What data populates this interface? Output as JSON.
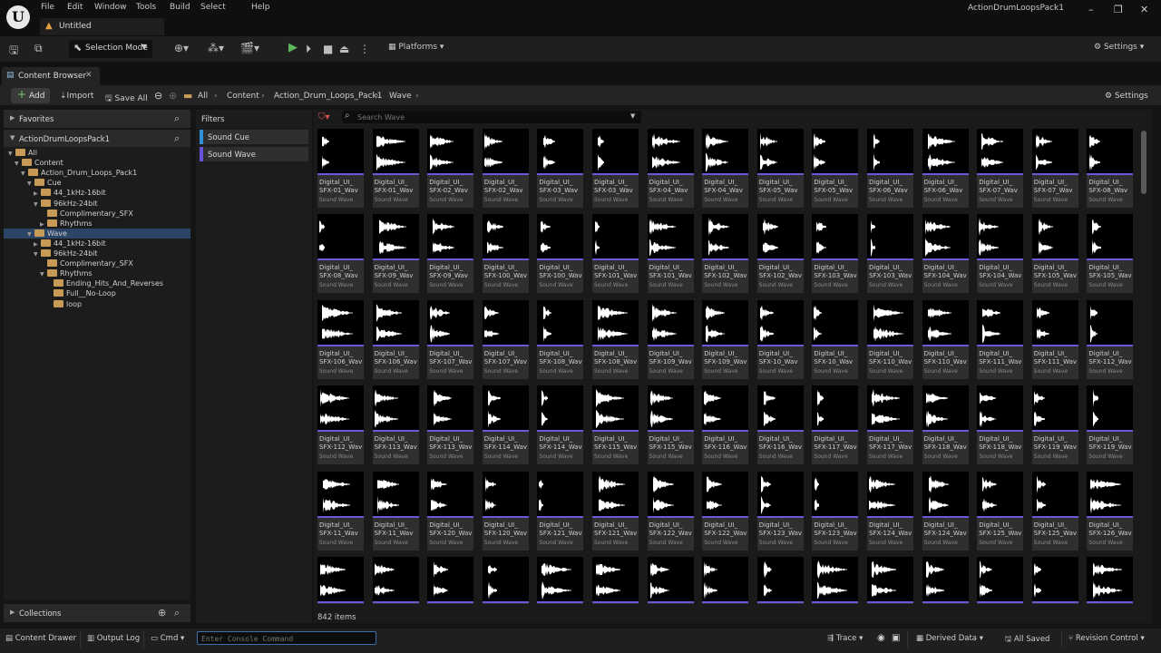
{
  "menu": [
    "File",
    "Edit",
    "Window",
    "Tools",
    "Build",
    "Select",
    "Help"
  ],
  "document_tab": "Untitled",
  "project_name": "ActionDrumLoopsPack1",
  "toolbar": {
    "selection_mode": "Selection Mode",
    "platforms": "Platforms",
    "settings": "Settings"
  },
  "content_browser": {
    "tab_label": "Content Browser",
    "add_label": "Add",
    "import_label": "Import",
    "save_all_label": "Save All",
    "breadcrumb": [
      "All",
      "Content",
      "Action_Drum_Loops_Pack1",
      "Wave"
    ],
    "settings_label": "Settings",
    "favorites_label": "Favorites",
    "project_label": "ActionDrumLoopsPack1",
    "collections_label": "Collections",
    "filters_label": "Filters",
    "filters": [
      {
        "label": "Sound Cue",
        "color": "#2f8fd8"
      },
      {
        "label": "Sound Wave",
        "color": "#6a4fd8"
      }
    ],
    "search_placeholder": "Search Wave",
    "item_count": "842 items",
    "tree": [
      {
        "label": "All",
        "depth": 0,
        "arrow": "▼"
      },
      {
        "label": "Content",
        "depth": 1,
        "arrow": "▼"
      },
      {
        "label": "Action_Drum_Loops_Pack1",
        "depth": 2,
        "arrow": "▼"
      },
      {
        "label": "Cue",
        "depth": 3,
        "arrow": "▼"
      },
      {
        "label": "44_1kHz-16bit",
        "depth": 4,
        "arrow": "▶"
      },
      {
        "label": "96kHz-24bit",
        "depth": 4,
        "arrow": "▼"
      },
      {
        "label": "Complimentary_SFX",
        "depth": 5,
        "arrow": ""
      },
      {
        "label": "Rhythms",
        "depth": 5,
        "arrow": "▶"
      },
      {
        "label": "Wave",
        "depth": 3,
        "arrow": "▼"
      },
      {
        "label": "44_1kHz-16bit",
        "depth": 4,
        "arrow": "▶"
      },
      {
        "label": "96kHz-24bit",
        "depth": 4,
        "arrow": "▼"
      },
      {
        "label": "Complimentary_SFX",
        "depth": 5,
        "arrow": ""
      },
      {
        "label": "Rhythms",
        "depth": 5,
        "arrow": "▼"
      },
      {
        "label": "Ending_Hits_And_Reverses",
        "depth": 6,
        "arrow": ""
      },
      {
        "label": "Full__No-Loop",
        "depth": 6,
        "arrow": ""
      },
      {
        "label": "loop",
        "depth": 6,
        "arrow": ""
      }
    ],
    "asset_type_label": "Sound Wave",
    "asset_name_prefix": "Digital_UI_",
    "assets": [
      "SFX-01_Wav",
      "SFX-01_Wav",
      "SFX-02_Wav",
      "SFX-02_Wav",
      "SFX-03_Wav",
      "SFX-03_Wav",
      "SFX-04_Wav",
      "SFX-04_Wav",
      "SFX-05_Wav",
      "SFX-05_Wav",
      "SFX-06_Wav",
      "SFX-06_Wav",
      "SFX-07_Wav",
      "SFX-07_Wav",
      "SFX-08_Wav",
      "SFX-08_Wav",
      "SFX-09_Wav",
      "SFX-09_Wav",
      "SFX-100_Wav",
      "SFX-100_Wav",
      "SFX-101_Wav",
      "SFX-101_Wav",
      "SFX-102_Wav",
      "SFX-102_Wav",
      "SFX-103_Wav",
      "SFX-103_Wav",
      "SFX-104_Wav",
      "SFX-104_Wav",
      "SFX-105_Wav",
      "SFX-105_Wav",
      "SFX-106_Wav",
      "SFX-106_Wav",
      "SFX-107_Wav",
      "SFX-107_Wav",
      "SFX-108_Wav",
      "SFX-108_Wav",
      "SFX-109_Wav",
      "SFX-109_Wav",
      "SFX-10_Wav",
      "SFX-10_Wav",
      "SFX-110_Wav",
      "SFX-110_Wav",
      "SFX-111_Wav",
      "SFX-111_Wav",
      "SFX-112_Wav",
      "SFX-112_Wav",
      "SFX-113_Wav",
      "SFX-113_Wav",
      "SFX-114_Wav",
      "SFX-114_Wav",
      "SFX-115_Wav",
      "SFX-115_Wav",
      "SFX-116_Wav",
      "SFX-116_Wav",
      "SFX-117_Wav",
      "SFX-117_Wav",
      "SFX-118_Wav",
      "SFX-118_Wav",
      "SFX-119_Wav",
      "SFX-119_Wav",
      "SFX-11_Wav",
      "SFX-11_Wav",
      "SFX-120_Wav",
      "SFX-120_Wav",
      "SFX-121_Wav",
      "SFX-121_Wav",
      "SFX-122_Wav",
      "SFX-122_Wav",
      "SFX-123_Wav",
      "SFX-123_Wav",
      "SFX-124_Wav",
      "SFX-124_Wav",
      "SFX-125_Wav",
      "SFX-125_Wav",
      "SFX-126_Wav",
      "",
      "",
      "",
      "",
      "",
      "",
      "",
      "",
      "",
      "",
      "",
      "",
      "",
      "",
      ""
    ]
  },
  "statusbar": {
    "content_drawer": "Content Drawer",
    "output_log": "Output Log",
    "cmd": "Cmd",
    "console_placeholder": "Enter Console Command",
    "trace": "Trace",
    "derived_data": "Derived Data",
    "all_saved": "All Saved",
    "revision_control": "Revision Control"
  },
  "accent_colors": {
    "sound_wave": "#6a5ad8",
    "sound_cue": "#2f8fd8",
    "play": "#5cb85c",
    "selected_row": "#2c4566"
  }
}
